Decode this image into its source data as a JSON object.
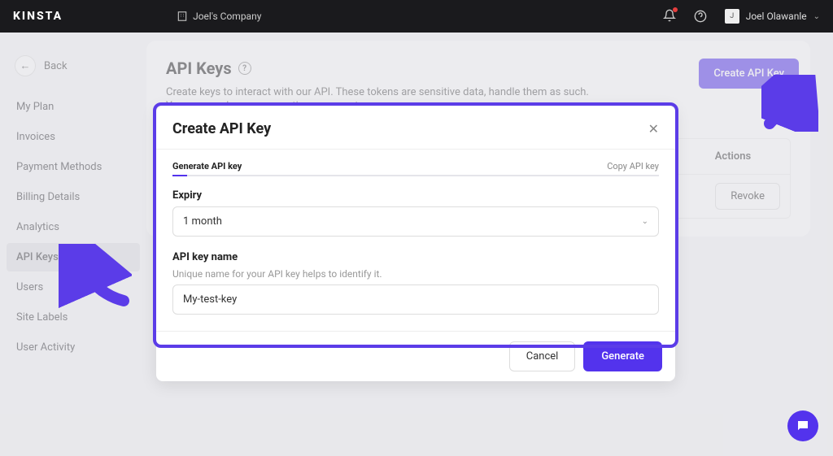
{
  "topbar": {
    "logo": "KINSTA",
    "company": "Joel's Company",
    "user_name": "Joel Olawanle"
  },
  "sidebar": {
    "back": "Back",
    "items": [
      {
        "label": "My Plan"
      },
      {
        "label": "Invoices"
      },
      {
        "label": "Payment Methods"
      },
      {
        "label": "Billing Details"
      },
      {
        "label": "Analytics"
      },
      {
        "label": "API Keys"
      },
      {
        "label": "Users"
      },
      {
        "label": "Site Labels"
      },
      {
        "label": "User Activity"
      }
    ],
    "active_index": 5
  },
  "page": {
    "title": "API Keys",
    "desc1": "Create keys to interact with our API. These tokens are sensitive data, handle them as such.",
    "desc2": "You can revoke access anytime you want.",
    "create_btn": "Create API Key",
    "table": {
      "actions_header": "Actions",
      "revoke_btn": "Revoke"
    }
  },
  "modal": {
    "title": "Create API Key",
    "step_active": "Generate API key",
    "step_inactive": "Copy API key",
    "expiry_label": "Expiry",
    "expiry_value": "1 month",
    "name_label": "API key name",
    "name_hint": "Unique name for your API key helps to identify it.",
    "name_value": "My-test-key",
    "cancel": "Cancel",
    "generate": "Generate"
  },
  "colors": {
    "accent": "#5333ed"
  }
}
